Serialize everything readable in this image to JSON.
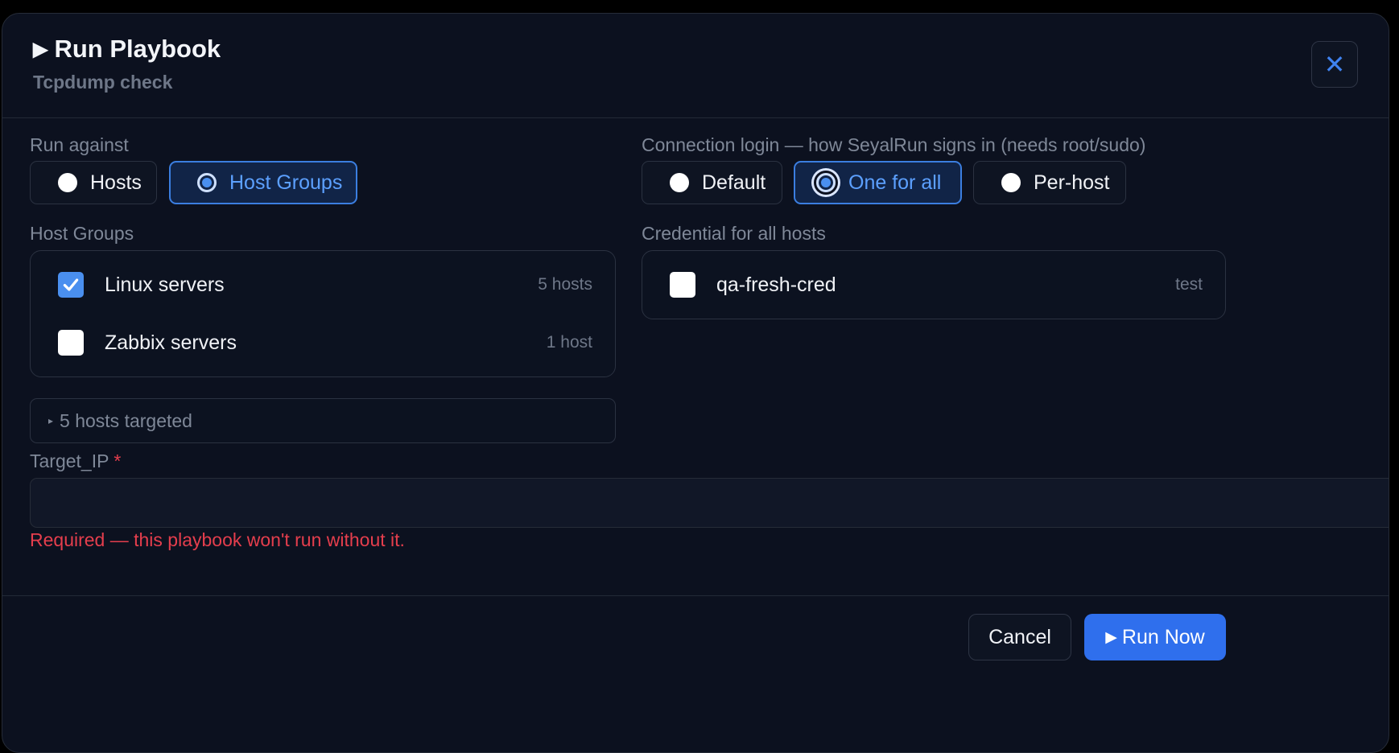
{
  "dialog": {
    "title": "Run Playbook",
    "subtitle": "Tcpdump check",
    "play_glyph": "▶",
    "close_glyph": "✕"
  },
  "run_against": {
    "label": "Run against",
    "options": [
      {
        "label": "Hosts",
        "selected": false
      },
      {
        "label": "Host Groups",
        "selected": true
      }
    ]
  },
  "connection_login": {
    "label": "Connection login — how SeyalRun signs in (needs root/sudo)",
    "options": [
      {
        "label": "Default",
        "selected": false
      },
      {
        "label": "One for all",
        "selected": true
      },
      {
        "label": "Per-host",
        "selected": false
      }
    ]
  },
  "host_groups": {
    "label": "Host Groups",
    "items": [
      {
        "name": "Linux servers",
        "count": "5 hosts",
        "checked": true
      },
      {
        "name": "Zabbix servers",
        "count": "1 host",
        "checked": false
      }
    ]
  },
  "credential": {
    "label": "Credential for all hosts",
    "items": [
      {
        "name": "qa-fresh-cred",
        "meta": "test",
        "checked": false
      }
    ]
  },
  "targeted": {
    "glyph": "▸",
    "text": "5 hosts targeted"
  },
  "target_ip": {
    "label": "Target_IP",
    "required_mark": "*",
    "value": "",
    "error": "Required — this playbook won't run without it."
  },
  "footer": {
    "cancel_label": "Cancel",
    "run_glyph": "▶",
    "run_label": "Run Now"
  },
  "colors": {
    "background": "#0c111f",
    "accent": "#2f6fed",
    "error": "#e53e4d",
    "selected_text": "#5ca0ff"
  }
}
